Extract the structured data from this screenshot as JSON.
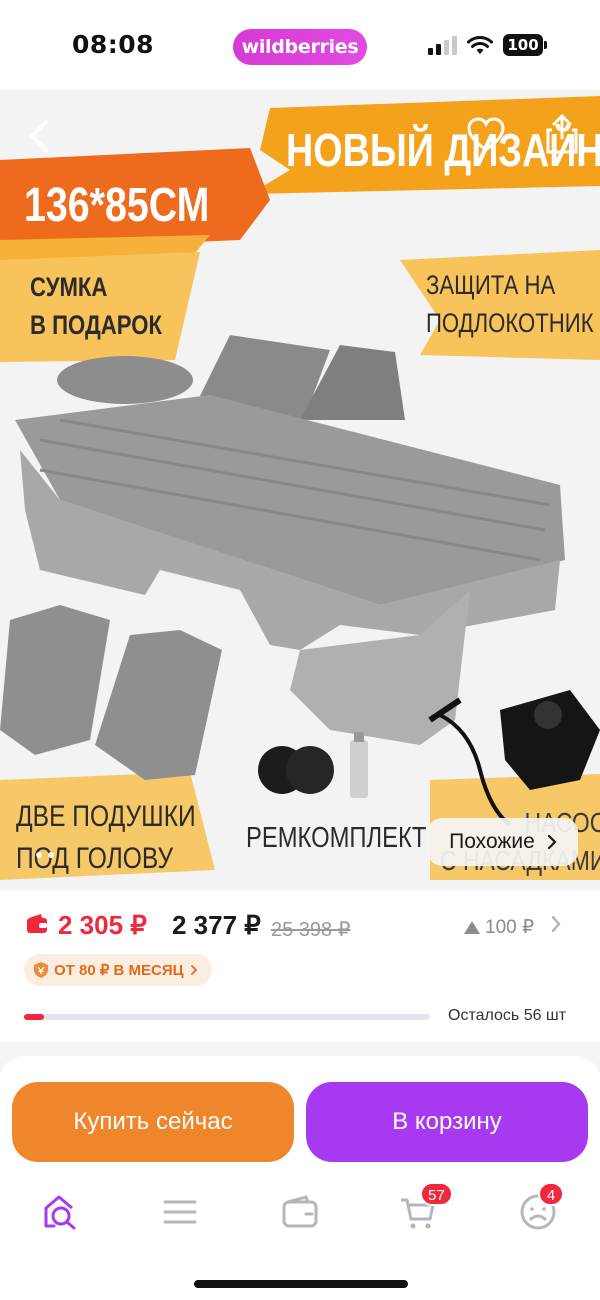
{
  "status_bar": {
    "time": "08:08",
    "brand": "wildberries",
    "battery": "100"
  },
  "product_image": {
    "headline": "НОВЫЙ ДИЗАЙН",
    "size": "136*85СМ",
    "bag_line1": "СУМКА",
    "bag_line2": "В ПОДАРОК",
    "protect_line1": "ЗАЩИТА НА",
    "protect_line2": "ПОДЛОКОТНИК",
    "pillows_line1": "ДВЕ ПОДУШКИ",
    "pillows_line2": "ПОД ГОЛОВУ",
    "repair": "РЕМКОМПЛЕКТ",
    "pump_line1": "НАСОС",
    "pump_line2": "С НАСАДКАМИ",
    "similar_label": "Похожие"
  },
  "price": {
    "wallet_price": "2 305 ₽",
    "price": "2 377 ₽",
    "old_price": "25 398 ₽",
    "bonus": "100 ₽",
    "installment": "ОТ 80 ₽ В МЕСЯЦ",
    "stock_text": "Осталось 56 шт",
    "stock_level_percent": 5
  },
  "actions": {
    "buy_now": "Купить сейчас",
    "add_to_cart": "В корзину"
  },
  "tabbar": {
    "cart_count": "57",
    "profile_count": "4"
  },
  "colors": {
    "brand": "#d63ad4",
    "price_red": "#f0283c",
    "buy_now": "#f0862b",
    "cart": "#a73af0"
  }
}
